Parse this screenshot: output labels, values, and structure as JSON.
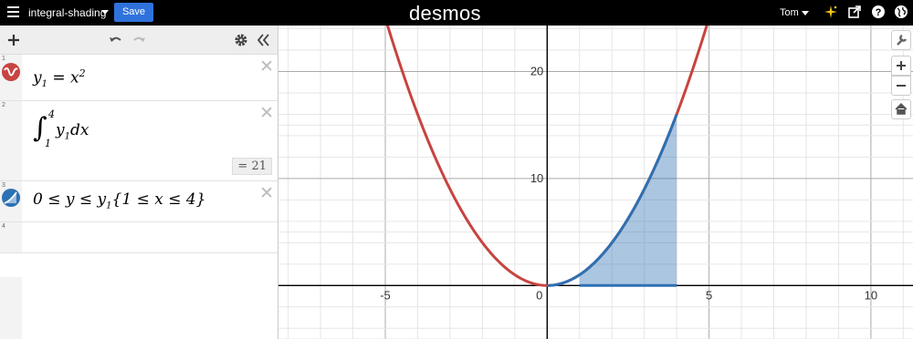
{
  "header": {
    "graph_title": "integral-shading",
    "save_label": "Save",
    "logo": "desmos",
    "user_name": "Tom"
  },
  "icons": {
    "menu": "hamburger-menu-icon",
    "title_dropdown": "caret-down-icon",
    "user_dropdown": "caret-down-icon",
    "whats_new": "sparkle-icon",
    "share": "share-icon",
    "help": "help-icon",
    "language": "globe-icon",
    "add": "plus-icon",
    "undo": "undo-icon",
    "redo": "redo-icon",
    "settings": "gear-icon",
    "collapse": "double-chevron-left-icon",
    "wrench": "wrench-icon",
    "zoom_in": "zoom-in-icon",
    "zoom_out": "zoom-out-icon",
    "home": "home-icon",
    "delete": "close-icon"
  },
  "expressions": [
    {
      "number": "1",
      "latex": "y_1 = x^2",
      "color": "#c74440",
      "icon": "graph-curve-icon"
    },
    {
      "number": "2",
      "latex": "\\int_1^4 y_1 dx",
      "result": "= 21"
    },
    {
      "number": "3",
      "latex": "0 \\le y \\le y_1 \\{1 \\le x \\le 4\\}",
      "color": "#2d70b3",
      "icon": "shaded-region-icon"
    },
    {
      "number": "4",
      "latex": ""
    }
  ],
  "graph": {
    "x_ticks": [
      "-5",
      "0",
      "5",
      "10"
    ],
    "y_ticks": [
      "10",
      "20"
    ],
    "x_range": [
      -8.3,
      11.3
    ],
    "y_range": [
      -5,
      24.3
    ],
    "grid": true,
    "minor_grid": true,
    "colors": {
      "curve": "#c74440",
      "shading": "#2d70b3"
    }
  }
}
